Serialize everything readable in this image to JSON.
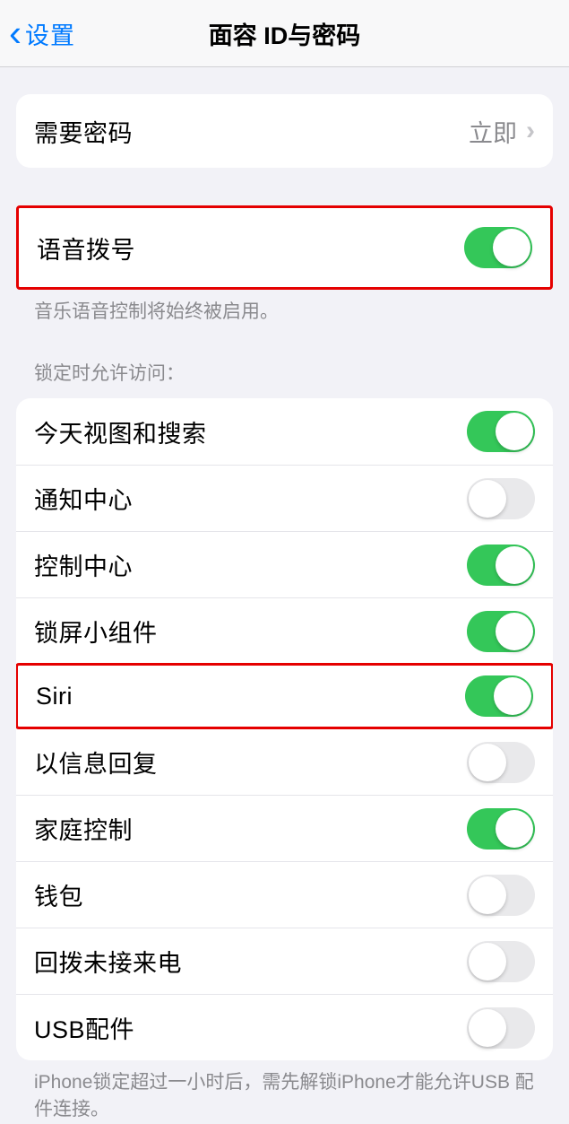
{
  "nav": {
    "back": "设置",
    "title": "面容 ID与密码"
  },
  "passcode": {
    "label": "需要密码",
    "value": "立即"
  },
  "voice_dial": {
    "label": "语音拨号",
    "toggle": true,
    "footer": "音乐语音控制将始终被启用。"
  },
  "locked_access": {
    "header": "锁定时允许访问：",
    "items": [
      {
        "label": "今天视图和搜索",
        "toggle": true
      },
      {
        "label": "通知中心",
        "toggle": false
      },
      {
        "label": "控制中心",
        "toggle": true
      },
      {
        "label": "锁屏小组件",
        "toggle": true
      },
      {
        "label": "Siri",
        "toggle": true
      },
      {
        "label": "以信息回复",
        "toggle": false
      },
      {
        "label": "家庭控制",
        "toggle": true
      },
      {
        "label": "钱包",
        "toggle": false
      },
      {
        "label": "回拨未接来电",
        "toggle": false
      },
      {
        "label": "USB配件",
        "toggle": false
      }
    ],
    "footer": "iPhone锁定超过一小时后，需先解锁iPhone才能允许USB 配件连接。"
  }
}
